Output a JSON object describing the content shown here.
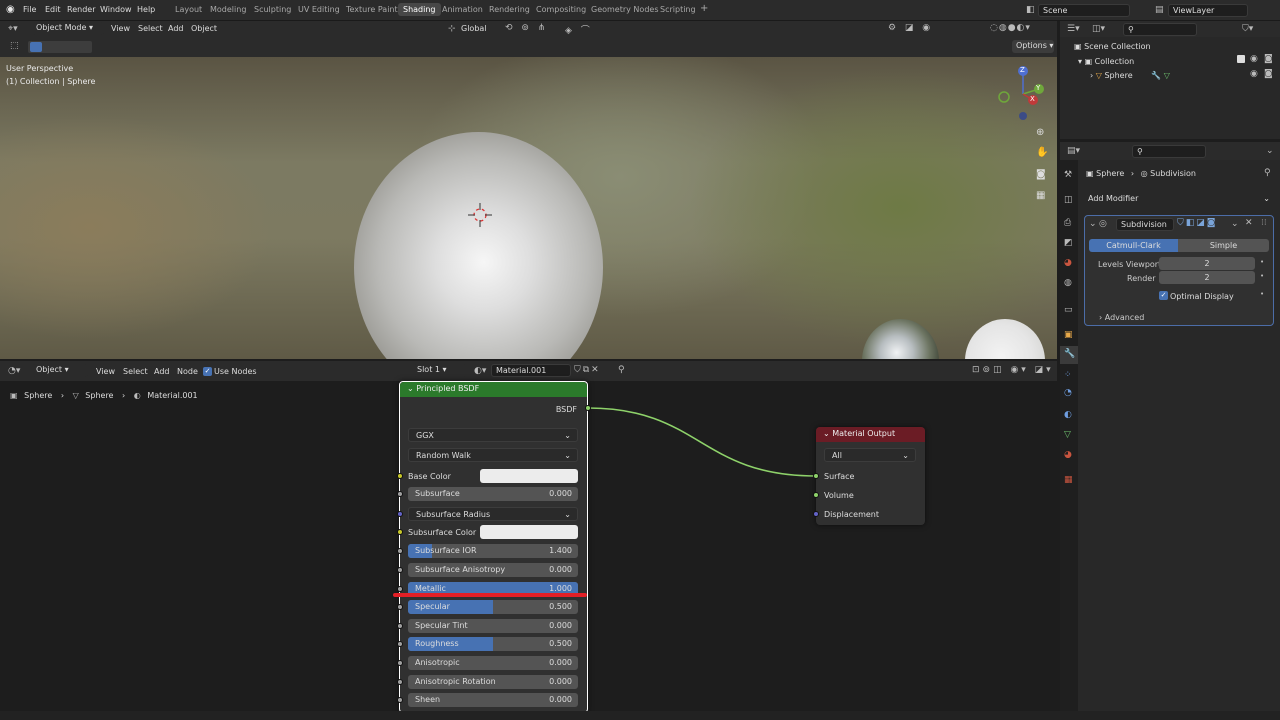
{
  "menubar": {
    "file": "File",
    "edit": "Edit",
    "render": "Render",
    "window": "Window",
    "help": "Help"
  },
  "workspaces": [
    "Layout",
    "Modeling",
    "Sculpting",
    "UV Editing",
    "Texture Paint",
    "Shading",
    "Animation",
    "Rendering",
    "Compositing",
    "Geometry Nodes",
    "Scripting"
  ],
  "workspace_add": "+",
  "scene": {
    "name": "Scene",
    "view_layer": "ViewLayer"
  },
  "viewport": {
    "mode": "Object Mode",
    "view": "View",
    "select": "Select",
    "add": "Add",
    "object": "Object",
    "orientation": "Global",
    "options": "Options",
    "overlay_perspective": "User Perspective",
    "overlay_collection": "(1) Collection | Sphere",
    "gizmo": {
      "x": "X",
      "y": "Y",
      "z": "Z"
    }
  },
  "outliner": {
    "root": "Scene Collection",
    "collection": "Collection",
    "object": "Sphere"
  },
  "properties": {
    "breadcrumb_object": "Sphere",
    "breadcrumb_modifier": "Subdivision",
    "add_modifier": "Add Modifier",
    "modifier_name": "Subdivision",
    "catmull_clark": "Catmull-Clark",
    "simple": "Simple",
    "levels_viewport_label": "Levels Viewport",
    "levels_viewport_value": "2",
    "render_label": "Render",
    "render_value": "2",
    "optimal_display": "Optimal Display",
    "advanced": "Advanced"
  },
  "node_editor": {
    "type": "Object",
    "view": "View",
    "select": "Select",
    "add": "Add",
    "node": "Node",
    "use_nodes": "Use Nodes",
    "slot": "Slot 1",
    "material": "Material.001",
    "breadcrumb": [
      "Sphere",
      "Sphere",
      "Material.001"
    ]
  },
  "bsdf_node": {
    "title": "Principled BSDF",
    "output": "BSDF",
    "distribution": "GGX",
    "subsurface_method": "Random Walk",
    "base_color": "Base Color",
    "subsurface_radius": "Subsurface Radius",
    "subsurface_color": "Subsurface Color",
    "rows": [
      {
        "label": "Subsurface",
        "value": "0.000",
        "fill": 0.0
      },
      {
        "label": "Subsurface IOR",
        "value": "1.400",
        "fill": 0.14
      },
      {
        "label": "Subsurface Anisotropy",
        "value": "0.000",
        "fill": 0.0
      },
      {
        "label": "Metallic",
        "value": "1.000",
        "fill": 1.0
      },
      {
        "label": "Specular",
        "value": "0.500",
        "fill": 0.5
      },
      {
        "label": "Specular Tint",
        "value": "0.000",
        "fill": 0.0
      },
      {
        "label": "Roughness",
        "value": "0.500",
        "fill": 0.5
      },
      {
        "label": "Anisotropic",
        "value": "0.000",
        "fill": 0.0
      },
      {
        "label": "Anisotropic Rotation",
        "value": "0.000",
        "fill": 0.0
      },
      {
        "label": "Sheen",
        "value": "0.000",
        "fill": 0.0
      }
    ]
  },
  "output_node": {
    "title": "Material Output",
    "target": "All",
    "surface": "Surface",
    "volume": "Volume",
    "displacement": "Displacement"
  },
  "colors": {
    "accent": "#4772b3",
    "shader_header": "#2b7a2b",
    "output_header": "#6b1c25",
    "link": "#8ed26a",
    "highlight": "#e31f26"
  },
  "icons": [
    "blender-logo-icon",
    "search-icon",
    "eye-icon",
    "camera-icon",
    "wrench-icon",
    "zoom-icon",
    "hand-icon",
    "grid-icon",
    "pin-icon",
    "filter-icon"
  ]
}
